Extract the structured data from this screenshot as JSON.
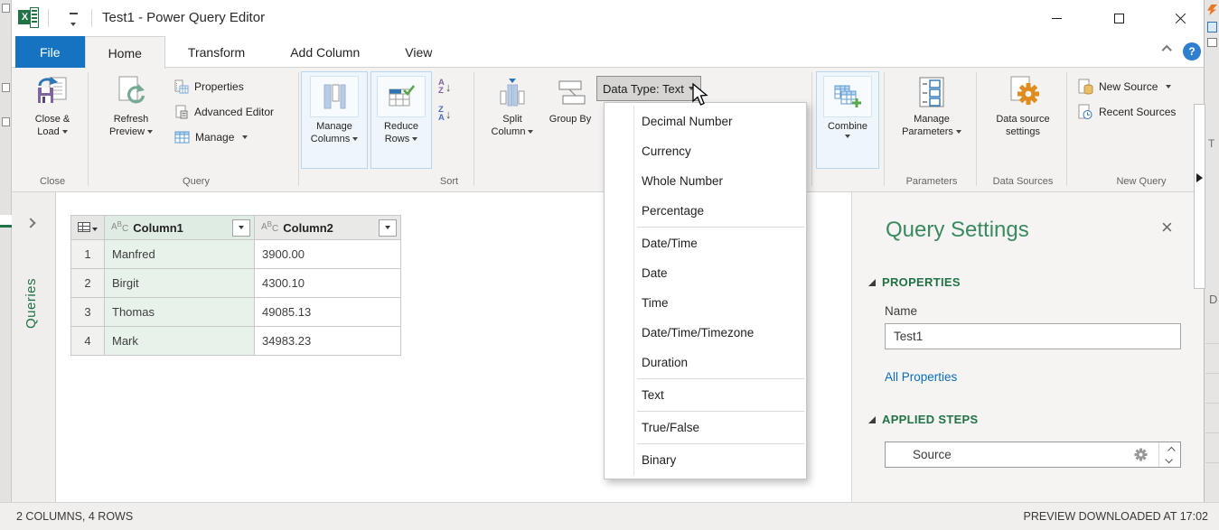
{
  "titlebar": {
    "title": "Test1 - Power Query Editor"
  },
  "tabs": {
    "items": [
      "File",
      "Home",
      "Transform",
      "Add Column",
      "View"
    ],
    "active": "Home"
  },
  "help": {
    "label": "?"
  },
  "ribbon": {
    "close_group": {
      "label": "Close",
      "close_load": "Close & Load"
    },
    "query_group": {
      "label": "Query",
      "refresh": "Refresh Preview",
      "properties": "Properties",
      "advanced_editor": "Advanced Editor",
      "manage": "Manage"
    },
    "manage_columns": "Manage Columns",
    "reduce_rows": "Reduce Rows",
    "sort_group": {
      "label": "Sort"
    },
    "split_column": "Split Column",
    "group_by": "Group By",
    "data_type": {
      "label": "Data Type: Text"
    },
    "combine": "Combine",
    "parameters_group": {
      "label": "Parameters",
      "manage_parameters": "Manage Parameters"
    },
    "data_sources_group": {
      "label": "Data Sources",
      "settings": "Data source settings"
    },
    "new_query_group": {
      "label": "New Query",
      "new_source": "New Source",
      "recent_sources": "Recent Sources"
    }
  },
  "data_type_menu": {
    "items": [
      {
        "label": "Decimal Number"
      },
      {
        "label": "Currency"
      },
      {
        "label": "Whole Number"
      },
      {
        "label": "Percentage",
        "sep_after": true
      },
      {
        "label": "Date/Time"
      },
      {
        "label": "Date"
      },
      {
        "label": "Time"
      },
      {
        "label": "Date/Time/Timezone"
      },
      {
        "label": "Duration",
        "sep_after": true
      },
      {
        "label": "Text",
        "sep_after": true
      },
      {
        "label": "True/False",
        "sep_after": true
      },
      {
        "label": "Binary"
      }
    ]
  },
  "queries_pane": {
    "label": "Queries"
  },
  "grid": {
    "columns": [
      {
        "name": "Column1",
        "type_icon": "ABC",
        "selected": true
      },
      {
        "name": "Column2",
        "type_icon": "ABC",
        "selected": false
      }
    ],
    "rows": [
      {
        "num": "1",
        "cells": [
          "Manfred",
          "3900.00"
        ]
      },
      {
        "num": "2",
        "cells": [
          "Birgit",
          "4300.10"
        ]
      },
      {
        "num": "3",
        "cells": [
          "Thomas",
          "49085.13"
        ]
      },
      {
        "num": "4",
        "cells": [
          "Mark",
          "34983.23"
        ]
      }
    ]
  },
  "query_settings": {
    "title": "Query Settings",
    "properties_heading": "PROPERTIES",
    "name_label": "Name",
    "name_value": "Test1",
    "all_properties": "All Properties",
    "applied_steps_heading": "APPLIED STEPS",
    "steps": [
      {
        "label": "Source"
      }
    ]
  },
  "status_bar": {
    "left": "2 COLUMNS, 4 ROWS",
    "right": "PREVIEW DOWNLOADED AT 17:02"
  },
  "colors": {
    "excel_green": "#217346",
    "file_tab_blue": "#1673c1",
    "link_blue": "#0a6dbc",
    "selected_column_green": "#e6f2ea",
    "panel_title_green": "#3a8a60",
    "gear_orange": "#e08b1e"
  }
}
